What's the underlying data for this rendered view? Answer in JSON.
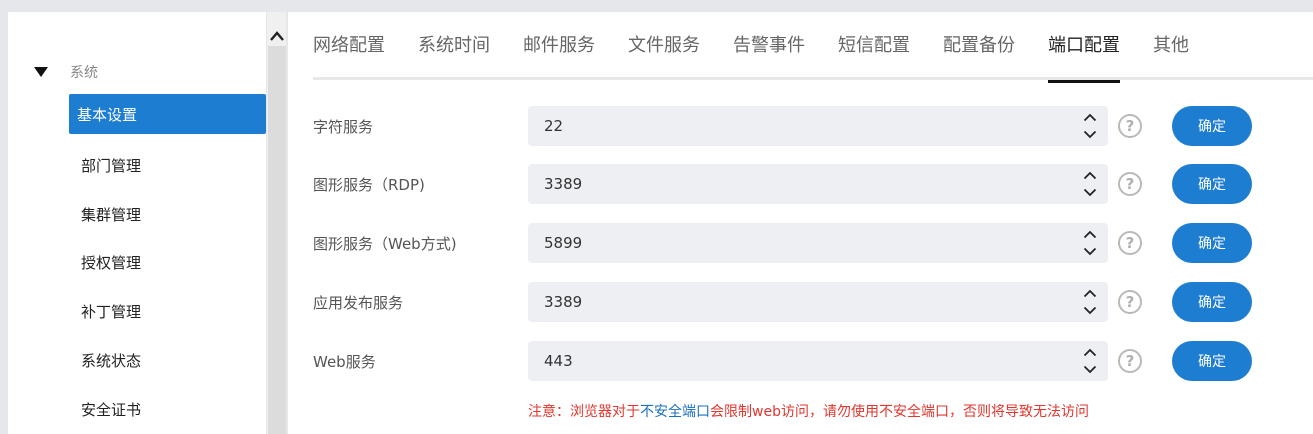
{
  "sidebar": {
    "group_label": "系统",
    "items": [
      {
        "label": "基本设置",
        "active": true
      },
      {
        "label": "部门管理",
        "active": false
      },
      {
        "label": "集群管理",
        "active": false
      },
      {
        "label": "授权管理",
        "active": false
      },
      {
        "label": "补丁管理",
        "active": false
      },
      {
        "label": "系统状态",
        "active": false
      },
      {
        "label": "安全证书",
        "active": false
      }
    ]
  },
  "tabs": [
    {
      "label": "网络配置"
    },
    {
      "label": "系统时间"
    },
    {
      "label": "邮件服务"
    },
    {
      "label": "文件服务"
    },
    {
      "label": "告警事件"
    },
    {
      "label": "短信配置"
    },
    {
      "label": "配置备份"
    },
    {
      "label": "端口配置",
      "active": true
    },
    {
      "label": "其他"
    }
  ],
  "ports": [
    {
      "label": "字符服务",
      "value": "22",
      "button": "确定"
    },
    {
      "label": "图形服务（RDP)",
      "value": "3389",
      "button": "确定"
    },
    {
      "label": "图形服务（Web方式)",
      "value": "5899",
      "button": "确定"
    },
    {
      "label": "应用发布服务",
      "value": "3389",
      "button": "确定"
    },
    {
      "label": "Web服务",
      "value": "443",
      "button": "确定"
    }
  ],
  "notice": {
    "prefix": "注意：浏览器对于",
    "link": "不安全端口",
    "suffix": "会限制web访问，请勿使用不安全端口，否则将导致无法访问"
  },
  "colors": {
    "accent": "#1d7dd1",
    "warning": "#e2362f"
  }
}
